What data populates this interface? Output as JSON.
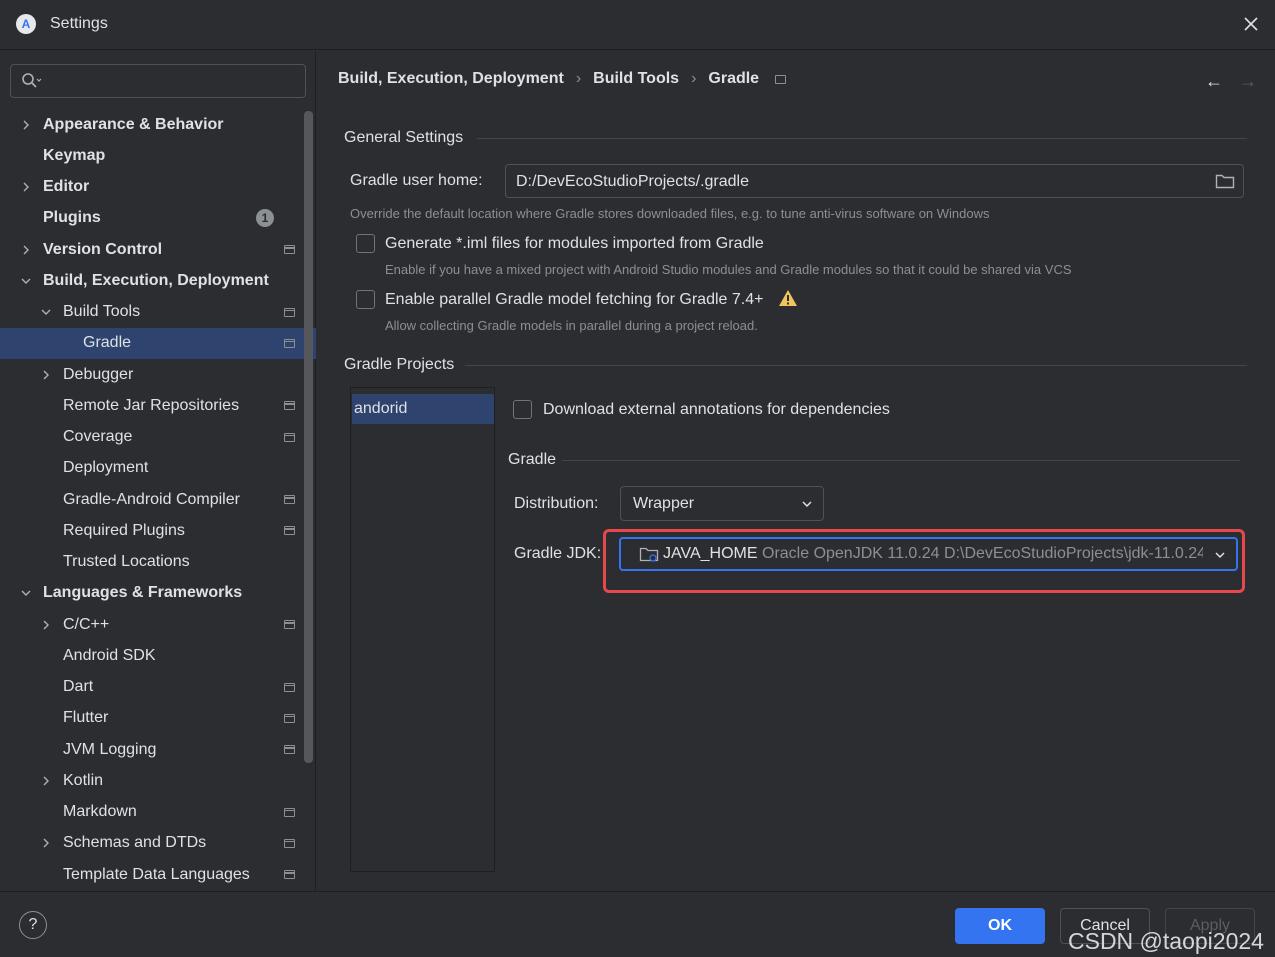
{
  "window": {
    "title": "Settings",
    "app_icon_letter": "A"
  },
  "search": {
    "placeholder": "",
    "value": ""
  },
  "sidebar": {
    "items": [
      {
        "label": "Appearance & Behavior",
        "bold": true,
        "chevron": "right"
      },
      {
        "label": "Keymap",
        "bold": true
      },
      {
        "label": "Editor",
        "bold": true,
        "chevron": "right"
      },
      {
        "label": "Plugins",
        "bold": true,
        "badge": "1"
      },
      {
        "label": "Version Control",
        "bold": true,
        "chevron": "right",
        "page_icon": true
      },
      {
        "label": "Build, Execution, Deployment",
        "bold": true,
        "chevron": "down"
      },
      {
        "label": "Build Tools",
        "chevron": "down",
        "page_icon": true
      },
      {
        "label": "Gradle",
        "selected": true,
        "page_icon": true
      },
      {
        "label": "Debugger",
        "chevron": "right"
      },
      {
        "label": "Remote Jar Repositories",
        "page_icon": true
      },
      {
        "label": "Coverage",
        "page_icon": true
      },
      {
        "label": "Deployment"
      },
      {
        "label": "Gradle-Android Compiler",
        "page_icon": true
      },
      {
        "label": "Required Plugins",
        "page_icon": true
      },
      {
        "label": "Trusted Locations"
      },
      {
        "label": "Languages & Frameworks",
        "bold": true,
        "chevron": "down"
      },
      {
        "label": "C/C++",
        "chevron": "right",
        "page_icon": true
      },
      {
        "label": "Android SDK"
      },
      {
        "label": "Dart",
        "page_icon": true
      },
      {
        "label": "Flutter",
        "page_icon": true
      },
      {
        "label": "JVM Logging",
        "page_icon": true
      },
      {
        "label": "Kotlin",
        "chevron": "right"
      },
      {
        "label": "Markdown",
        "page_icon": true
      },
      {
        "label": "Schemas and DTDs",
        "chevron": "right",
        "page_icon": true
      },
      {
        "label": "Template Data Languages",
        "page_icon": true
      }
    ]
  },
  "breadcrumb": {
    "items": [
      "Build, Execution, Deployment",
      "Build Tools",
      "Gradle"
    ],
    "sep": "›"
  },
  "nav": {
    "back": "←",
    "forward": "→"
  },
  "general": {
    "title": "General Settings",
    "user_home_label": "Gradle user home:",
    "user_home_value": "D:/DevEcoStudioProjects/.gradle",
    "user_home_hint": "Override the default location where Gradle stores downloaded files, e.g. to tune anti-virus software on Windows",
    "iml_label": "Generate *.iml files for modules imported from Gradle",
    "iml_hint": "Enable if you have a mixed project with Android Studio modules and Gradle modules so that it could be shared via VCS",
    "parallel_label": "Enable parallel Gradle model fetching for Gradle 7.4+",
    "parallel_hint": "Allow collecting Gradle models in parallel during a project reload."
  },
  "projects": {
    "title": "Gradle Projects",
    "list": [
      "andorid"
    ],
    "annotations_label": "Download external annotations for dependencies",
    "gradle_title": "Gradle",
    "distribution_label": "Distribution:",
    "distribution_value": "Wrapper",
    "jdk_label": "Gradle JDK:",
    "jdk_name": "JAVA_HOME",
    "jdk_desc": " Oracle OpenJDK 11.0.24 D:\\DevEcoStudioProjects\\jdk-11.0.24"
  },
  "footer": {
    "help": "?",
    "ok": "OK",
    "cancel": "Cancel",
    "apply": "Apply"
  },
  "watermark": "CSDN @taopi2024",
  "colors": {
    "accent": "#3574f0",
    "highlight": "#e5484d",
    "selection": "#2e436e",
    "background": "#2b2d30"
  }
}
